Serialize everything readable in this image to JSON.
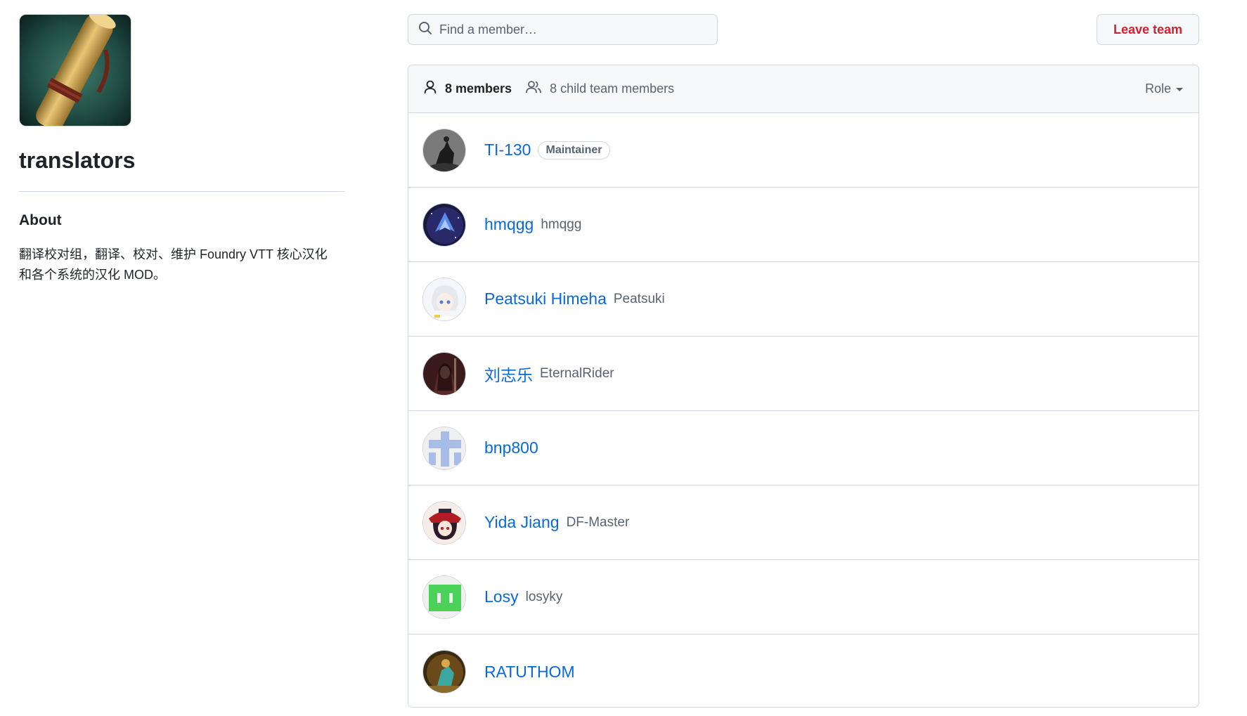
{
  "team": {
    "name": "translators",
    "about_heading": "About",
    "about_text": "翻译校对组，翻译、校对、维护 Foundry VTT 核心汉化和各个系统的汉化 MOD。"
  },
  "search": {
    "placeholder": "Find a member…"
  },
  "actions": {
    "leave_label": "Leave team"
  },
  "header": {
    "members_label": "8 members",
    "child_members_label": "8 child team members",
    "role_label": "Role"
  },
  "members": [
    {
      "name": "TI-130",
      "login": "",
      "badge": "Maintainer"
    },
    {
      "name": "hmqgg",
      "login": "hmqgg",
      "badge": ""
    },
    {
      "name": "Peatsuki Himeha",
      "login": "Peatsuki",
      "badge": ""
    },
    {
      "name": "刘志乐",
      "login": "EternalRider",
      "badge": ""
    },
    {
      "name": "bnp800",
      "login": "",
      "badge": ""
    },
    {
      "name": "Yida Jiang",
      "login": "DF-Master",
      "badge": ""
    },
    {
      "name": "Losy",
      "login": "losyky",
      "badge": ""
    },
    {
      "name": "RATUTHOM",
      "login": "",
      "badge": ""
    }
  ],
  "colors": {
    "link": "#0969da",
    "danger": "#cf222e",
    "muted": "#59636e",
    "border": "#d0d7de"
  }
}
